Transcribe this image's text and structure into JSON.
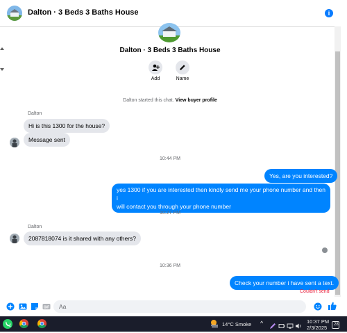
{
  "header": {
    "title": "Dalton · 3 Beds 3 Baths House"
  },
  "hero": {
    "title": "Dalton · 3 Beds 3 Baths House",
    "actions": [
      {
        "label": "Add"
      },
      {
        "label": "Name"
      }
    ]
  },
  "system_note": {
    "text": "Dalton started this chat.",
    "link": "View buyer profile"
  },
  "messages": {
    "sender1": "Dalton",
    "m1": "Hi is this 1300 for the house?",
    "m2": "Message sent",
    "ts1": "10:44 PM",
    "m3": "Yes, are you interested?",
    "m4_line1": "yes 1300 if you are interested then kindly send me your phone number and then i",
    "m4_line2": "will contact you through your phone number",
    "ts2": "10:27 PM",
    "sender2": "Dalton",
    "m5": "2087818074 is it shared with any others?",
    "ts3": "10:36 PM",
    "m6": "Check your number i have sent a text.",
    "m6_status": "Couldn't send"
  },
  "composer": {
    "placeholder": "Aa"
  },
  "taskbar": {
    "weather": "14°C  Smoke",
    "time": "10:37 PM",
    "date": "2/3/2025",
    "whatsapp_badge": "2",
    "notif_badge": "28"
  },
  "colors": {
    "accent": "#0084ff",
    "error": "#e41e3f",
    "incoming": "#e4e6eb"
  }
}
